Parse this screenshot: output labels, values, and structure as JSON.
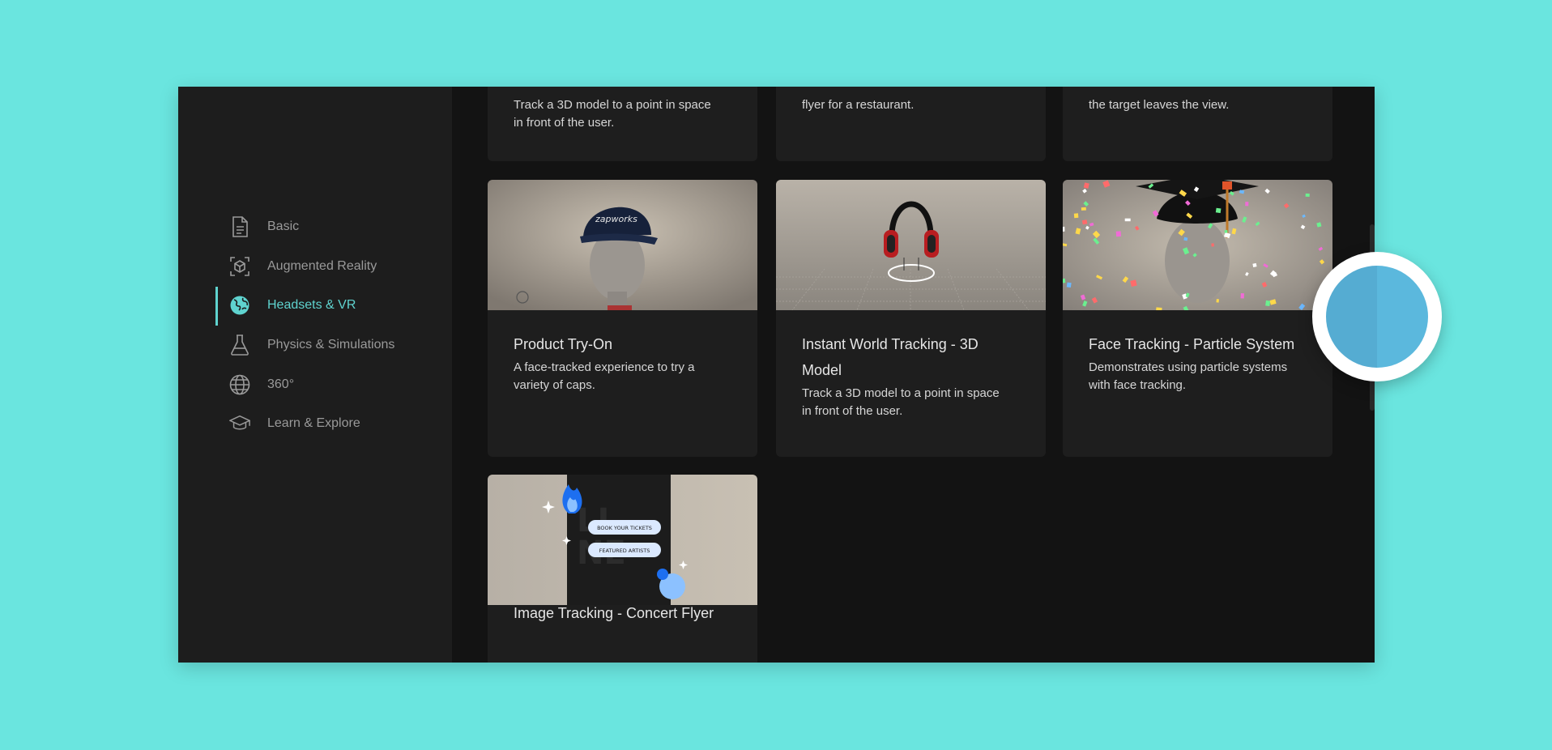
{
  "sidebar": {
    "items": [
      {
        "label": "Basic",
        "icon": "document-icon"
      },
      {
        "label": "Augmented Reality",
        "icon": "ar-cube-icon"
      },
      {
        "label": "Headsets & VR",
        "icon": "globe-filled-icon",
        "active": true
      },
      {
        "label": "Physics & Simulations",
        "icon": "flask-icon"
      },
      {
        "label": "360°",
        "icon": "globe-outline-icon"
      },
      {
        "label": "Learn & Explore",
        "icon": "graduation-cap-icon"
      }
    ]
  },
  "cards_top": [
    {
      "desc_lines": [
        "Track a 3D model to a point in space",
        "in front of the user."
      ]
    },
    {
      "desc_lines": [
        "flyer for a restaurant."
      ]
    },
    {
      "desc_lines": [
        "the target leaves the view."
      ]
    }
  ],
  "cards": [
    {
      "title": "Product Try-On",
      "desc_lines": [
        "A face-tracked experience to try a",
        "variety of caps."
      ],
      "thumb": "cap-on-head"
    },
    {
      "title_lines": [
        "Instant World Tracking - 3D",
        "Model"
      ],
      "desc_lines": [
        "Track a 3D model to a point in space",
        "in front of the user."
      ],
      "thumb": "headphones"
    },
    {
      "title": "Face Tracking - Particle System",
      "desc_lines": [
        "Demonstrates using particle systems",
        "with face tracking."
      ],
      "thumb": "confetti-head"
    },
    {
      "title": "Image Tracking - Concert Flyer",
      "thumb": "concert-flyer",
      "flyer_buttons": [
        "BOOK YOUR TICKETS",
        "FEATURED ARTISTS"
      ]
    }
  ],
  "colors": {
    "accent": "#5fd3cf",
    "background": "#6ae5df"
  }
}
